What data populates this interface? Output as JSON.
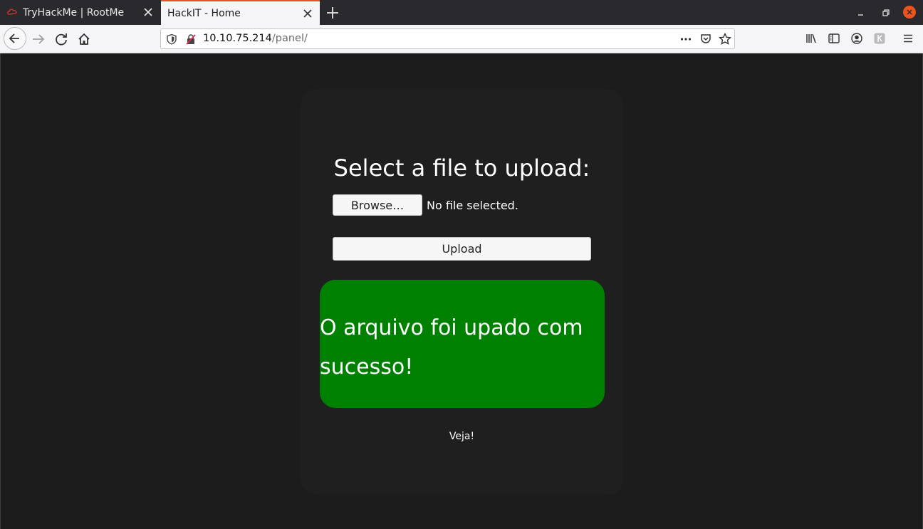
{
  "browser": {
    "tabs": [
      {
        "title": "TryHackMe | RootMe",
        "active": false
      },
      {
        "title": "HackIT - Home",
        "active": true
      }
    ],
    "url_host": "10.10.75.214",
    "url_path": "/panel/",
    "accent_color": "#e95420"
  },
  "page": {
    "heading": "Select a file to upload:",
    "browse_label": "Browse…",
    "no_file_text": "No file selected.",
    "upload_label": "Upload",
    "success_message": "O arquivo foi upado com sucesso!",
    "success_color": "#008000",
    "veja_link": "Veja!"
  }
}
